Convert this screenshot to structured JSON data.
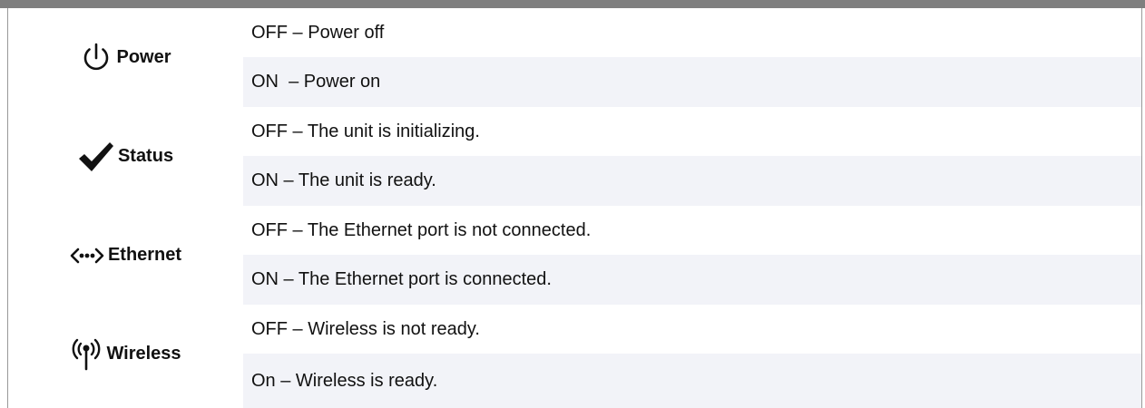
{
  "leds": [
    {
      "name": "Power",
      "icon": "power-icon",
      "off_text": "OFF – Power off",
      "on_text": "ON  – Power on"
    },
    {
      "name": "Status",
      "icon": "checkmark-icon",
      "off_text": "OFF – The unit is initializing.",
      "on_text": "ON – The unit is ready."
    },
    {
      "name": "Ethernet",
      "icon": "ethernet-icon",
      "off_text": "OFF – The Ethernet port is not connected.",
      "on_text": "ON – The Ethernet port is connected."
    },
    {
      "name": "Wireless",
      "icon": "wireless-icon",
      "off_text": "OFF – Wireless is not ready.",
      "on_text": "On – Wireless is ready."
    }
  ],
  "colors": {
    "top_bar": "#7f7f7f",
    "row_shade": "#f2f3f8",
    "text": "#111111"
  }
}
